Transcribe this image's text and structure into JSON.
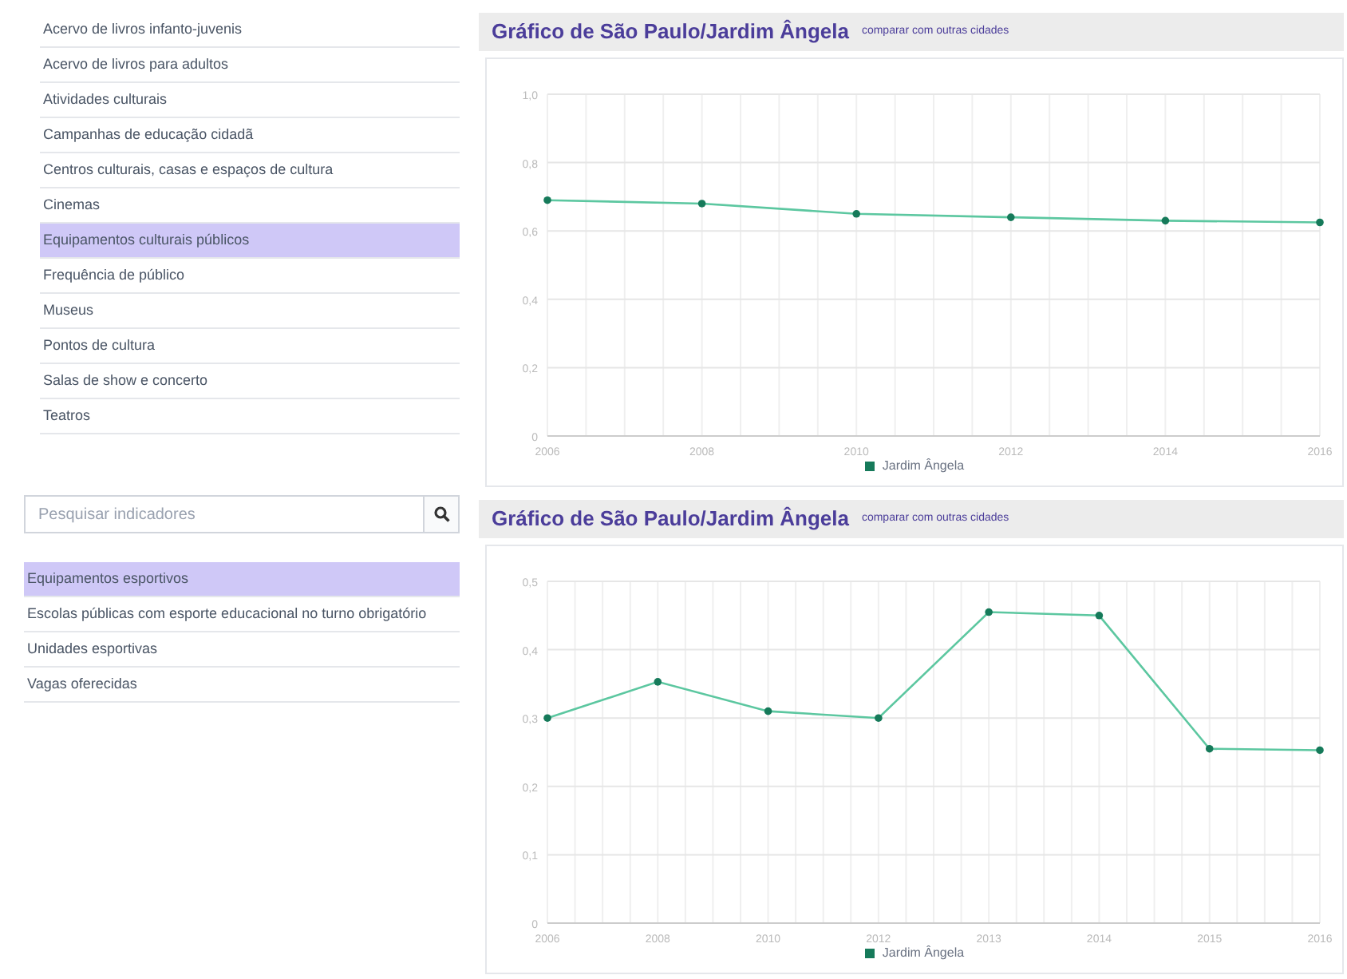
{
  "categories_list": {
    "items": [
      {
        "label": "Acervo de livros infanto-juvenis",
        "selected": false
      },
      {
        "label": "Acervo de livros para adultos",
        "selected": false
      },
      {
        "label": "Atividades culturais",
        "selected": false
      },
      {
        "label": "Campanhas de educação cidadã",
        "selected": false
      },
      {
        "label": "Centros culturais, casas e espaços de cultura",
        "selected": false
      },
      {
        "label": "Cinemas",
        "selected": false
      },
      {
        "label": "Equipamentos culturais públicos",
        "selected": true
      },
      {
        "label": "Frequência de público",
        "selected": false
      },
      {
        "label": "Museus",
        "selected": false
      },
      {
        "label": "Pontos de cultura",
        "selected": false
      },
      {
        "label": "Salas de show e concerto",
        "selected": false
      },
      {
        "label": "Teatros",
        "selected": false
      }
    ]
  },
  "search": {
    "placeholder": "Pesquisar indicadores"
  },
  "indicators_list": {
    "items": [
      {
        "label": "Equipamentos esportivos",
        "selected": true
      },
      {
        "label": "Escolas públicas com esporte educacional no turno obrigatório",
        "selected": false
      },
      {
        "label": "Unidades esportivas",
        "selected": false
      },
      {
        "label": "Vagas oferecidas",
        "selected": false
      }
    ]
  },
  "charts": [
    {
      "title": "Gráfico de São Paulo/Jardim Ângela",
      "compare_link": "comparar com outras cidades",
      "chart_data": {
        "type": "line",
        "grid": true,
        "categories": [
          "2006",
          "2008",
          "2010",
          "2012",
          "2014",
          "2016"
        ],
        "series": [
          {
            "name": "Jardim Ângela",
            "color": "#5cc7a0",
            "marker": true,
            "values": [
              0.69,
              0.68,
              0.65,
              0.64,
              0.63,
              0.625
            ]
          }
        ],
        "ylim": [
          0,
          1
        ],
        "yticks": [
          {
            "value": 0,
            "label": "0"
          },
          {
            "value": 0.2,
            "label": "0,2"
          },
          {
            "value": 0.4,
            "label": "0,4"
          },
          {
            "value": 0.6,
            "label": "0,6"
          },
          {
            "value": 0.8,
            "label": "0,8"
          },
          {
            "value": 1,
            "label": "1,0"
          }
        ]
      }
    },
    {
      "title": "Gráfico de São Paulo/Jardim Ângela",
      "compare_link": "comparar com outras cidades",
      "chart_data": {
        "type": "line",
        "grid": true,
        "categories": [
          "2006",
          "2008",
          "2010",
          "2012",
          "2013",
          "2014",
          "2015",
          "2016"
        ],
        "series": [
          {
            "name": "Jardim Ângela",
            "color": "#5cc7a0",
            "marker": true,
            "values": [
              0.3,
              0.353,
              0.31,
              0.3,
              0.455,
              0.45,
              0.255,
              0.253
            ]
          }
        ],
        "ylim": [
          0,
          0.5
        ],
        "yticks": [
          {
            "value": 0,
            "label": "0"
          },
          {
            "value": 0.1,
            "label": "0,1"
          },
          {
            "value": 0.2,
            "label": "0,2"
          },
          {
            "value": 0.3,
            "label": "0,3"
          },
          {
            "value": 0.4,
            "label": "0,4"
          },
          {
            "value": 0.5,
            "label": "0,5"
          }
        ]
      }
    }
  ]
}
